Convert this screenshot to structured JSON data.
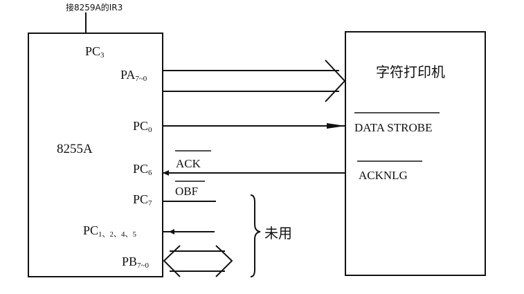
{
  "top_note": "接8259A的IR3",
  "chip_8255": {
    "name": "8255A",
    "pins": {
      "pc3": {
        "main": "PC",
        "sub": "3"
      },
      "pa": {
        "main": "PA",
        "sub": "7~0"
      },
      "pc0": {
        "main": "PC",
        "sub": "0"
      },
      "pc6": {
        "main": "PC",
        "sub": "6"
      },
      "pc7": {
        "main": "PC",
        "sub": "7"
      },
      "pc1245": {
        "main": "PC",
        "sub": "1、2、4、5"
      },
      "pb": {
        "main": "PB",
        "sub": "7~0"
      }
    }
  },
  "printer": {
    "name": "字符打印机",
    "data_strobe": "DATA STROBE",
    "acknlg": "ACKNLG"
  },
  "signals": {
    "ack": "ACK",
    "obf": "OBF"
  },
  "unused_label": "未用"
}
